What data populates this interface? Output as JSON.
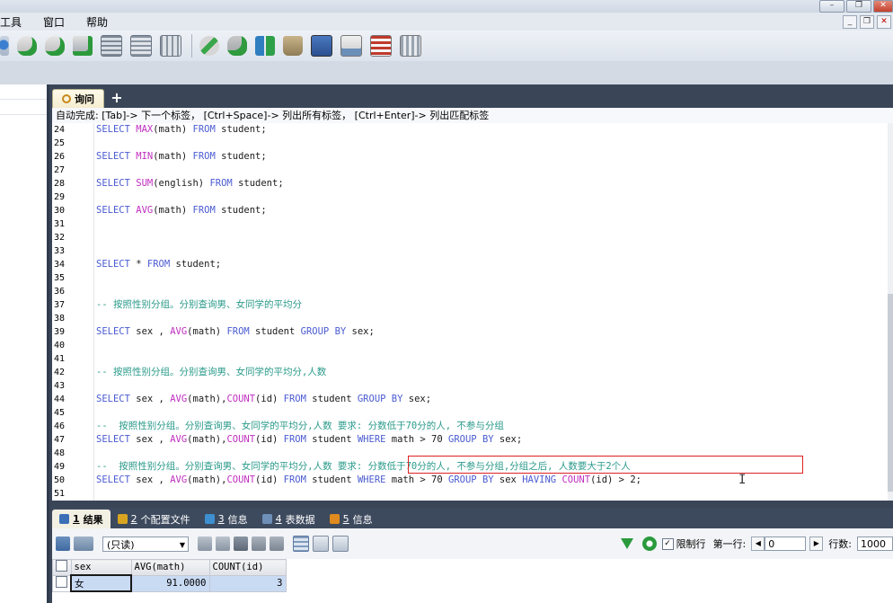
{
  "window": {
    "buttons": [
      "–",
      "❐",
      "✕"
    ],
    "mdi_buttons": [
      "_",
      "❐",
      "✕"
    ]
  },
  "menu": [
    "工具",
    "窗口",
    "帮助"
  ],
  "toolbar": {
    "icons": [
      "schema-sync-icon",
      "database-add-icon",
      "database-edit-icon",
      "backup-icon",
      "table-editor-icon",
      "table-list-icon",
      "data-grid-icon",
      "query-builder-icon",
      "import-icon",
      "compare-icon",
      "transfer-icon",
      "monitor-icon",
      "report-icon",
      "scheduler-icon"
    ]
  },
  "editor": {
    "tab_label": "询问",
    "tab_plus": "+",
    "hint": "自动完成: [Tab]-> 下一个标签， [Ctrl+Space]-> 列出所有标签， [Ctrl+Enter]-> 列出匹配标签",
    "lines": [
      {
        "n": "24",
        "parts": [
          [
            "kw",
            "SELECT "
          ],
          [
            "fn",
            "MAX"
          ],
          [
            "id",
            "(math) "
          ],
          [
            "kw",
            "FROM"
          ],
          [
            "id",
            " student;"
          ]
        ]
      },
      {
        "n": "25",
        "parts": []
      },
      {
        "n": "26",
        "parts": [
          [
            "kw",
            "SELECT "
          ],
          [
            "fn",
            "MIN"
          ],
          [
            "id",
            "(math) "
          ],
          [
            "kw",
            "FROM"
          ],
          [
            "id",
            " student;"
          ]
        ]
      },
      {
        "n": "27",
        "parts": []
      },
      {
        "n": "28",
        "parts": [
          [
            "kw",
            "SELECT "
          ],
          [
            "fn",
            "SUM"
          ],
          [
            "id",
            "(english) "
          ],
          [
            "kw",
            "FROM"
          ],
          [
            "id",
            " student;"
          ]
        ]
      },
      {
        "n": "29",
        "parts": []
      },
      {
        "n": "30",
        "parts": [
          [
            "kw",
            "SELECT "
          ],
          [
            "fn",
            "AVG"
          ],
          [
            "id",
            "(math) "
          ],
          [
            "kw",
            "FROM"
          ],
          [
            "id",
            " student;"
          ]
        ]
      },
      {
        "n": "31",
        "parts": []
      },
      {
        "n": "32",
        "parts": []
      },
      {
        "n": "33",
        "parts": []
      },
      {
        "n": "34",
        "parts": [
          [
            "kw",
            "SELECT"
          ],
          [
            "id",
            " * "
          ],
          [
            "kw",
            "FROM"
          ],
          [
            "id",
            " student;"
          ]
        ]
      },
      {
        "n": "35",
        "parts": []
      },
      {
        "n": "36",
        "parts": []
      },
      {
        "n": "37",
        "parts": [
          [
            "cm",
            "-- 按照性别分组。分别查询男、女同学的平均分"
          ]
        ]
      },
      {
        "n": "38",
        "parts": []
      },
      {
        "n": "39",
        "parts": [
          [
            "kw",
            "SELECT"
          ],
          [
            "id",
            " sex , "
          ],
          [
            "fn",
            "AVG"
          ],
          [
            "id",
            "(math) "
          ],
          [
            "kw",
            "FROM"
          ],
          [
            "id",
            " student "
          ],
          [
            "kw",
            "GROUP BY"
          ],
          [
            "id",
            " sex;"
          ]
        ]
      },
      {
        "n": "40",
        "parts": []
      },
      {
        "n": "41",
        "parts": []
      },
      {
        "n": "42",
        "parts": [
          [
            "cm",
            "-- 按照性别分组。分别查询男、女同学的平均分,人数"
          ]
        ]
      },
      {
        "n": "43",
        "parts": []
      },
      {
        "n": "44",
        "parts": [
          [
            "kw",
            "SELECT"
          ],
          [
            "id",
            " sex , "
          ],
          [
            "fn",
            "AVG"
          ],
          [
            "id",
            "(math),"
          ],
          [
            "fn",
            "COUNT"
          ],
          [
            "id",
            "(id) "
          ],
          [
            "kw",
            "FROM"
          ],
          [
            "id",
            " student "
          ],
          [
            "kw",
            "GROUP BY"
          ],
          [
            "id",
            " sex;"
          ]
        ]
      },
      {
        "n": "45",
        "parts": []
      },
      {
        "n": "46",
        "parts": [
          [
            "cm",
            "--  按照性别分组。分别查询男、女同学的平均分,人数 要求: 分数低于70分的人, 不参与分组"
          ]
        ]
      },
      {
        "n": "47",
        "parts": [
          [
            "kw",
            "SELECT"
          ],
          [
            "id",
            " sex , "
          ],
          [
            "fn",
            "AVG"
          ],
          [
            "id",
            "(math),"
          ],
          [
            "fn",
            "COUNT"
          ],
          [
            "id",
            "(id) "
          ],
          [
            "kw",
            "FROM"
          ],
          [
            "id",
            " student "
          ],
          [
            "kw",
            "WHERE"
          ],
          [
            "id",
            " math > 70 "
          ],
          [
            "kw",
            "GROUP BY"
          ],
          [
            "id",
            " sex;"
          ]
        ]
      },
      {
        "n": "48",
        "parts": []
      },
      {
        "n": "49",
        "parts": [
          [
            "cm",
            "--  按照性别分组。分别查询男、女同学的平均分,人数 要求: 分数低于70分的人, 不参与分组,分组之后, 人数要大于2个人"
          ]
        ]
      },
      {
        "n": "50",
        "parts": [
          [
            "kw",
            "SELECT"
          ],
          [
            "id",
            " sex , "
          ],
          [
            "fn",
            "AVG"
          ],
          [
            "id",
            "(math),"
          ],
          [
            "fn",
            "COUNT"
          ],
          [
            "id",
            "(id) "
          ],
          [
            "kw",
            "FROM"
          ],
          [
            "id",
            " student "
          ],
          [
            "kw",
            "WHERE"
          ],
          [
            "id",
            " math > 70 "
          ],
          [
            "kw",
            "GROUP BY"
          ],
          [
            "id",
            " sex "
          ],
          [
            "kw",
            "HAVING"
          ],
          [
            "id",
            " "
          ],
          [
            "fn",
            "COUNT"
          ],
          [
            "id",
            "(id) > 2;"
          ]
        ]
      },
      {
        "n": "51",
        "parts": []
      }
    ]
  },
  "results": {
    "tabs": [
      {
        "num": "1",
        "label": "结果",
        "icon_color": "#3b6fb6"
      },
      {
        "num": "2",
        "label": "个配置文件",
        "icon_color": "#d9a520"
      },
      {
        "num": "3",
        "label": "信息",
        "icon_color": "#3d8fd0"
      },
      {
        "num": "4",
        "label": "表数据",
        "icon_color": "#6d8fb8"
      },
      {
        "num": "5",
        "label": "信息",
        "icon_color": "#e08a20"
      }
    ],
    "mode_select": "(只读)",
    "limit_label": "限制行",
    "limit_checked": "✓",
    "first_row_label": "第一行:",
    "first_row_value": "0",
    "rows_label": "行数:",
    "rows_value": "1000",
    "columns": [
      "sex",
      "AVG(math)",
      "COUNT(id)"
    ],
    "rows": [
      [
        "女",
        "91.0000",
        "3"
      ]
    ]
  }
}
